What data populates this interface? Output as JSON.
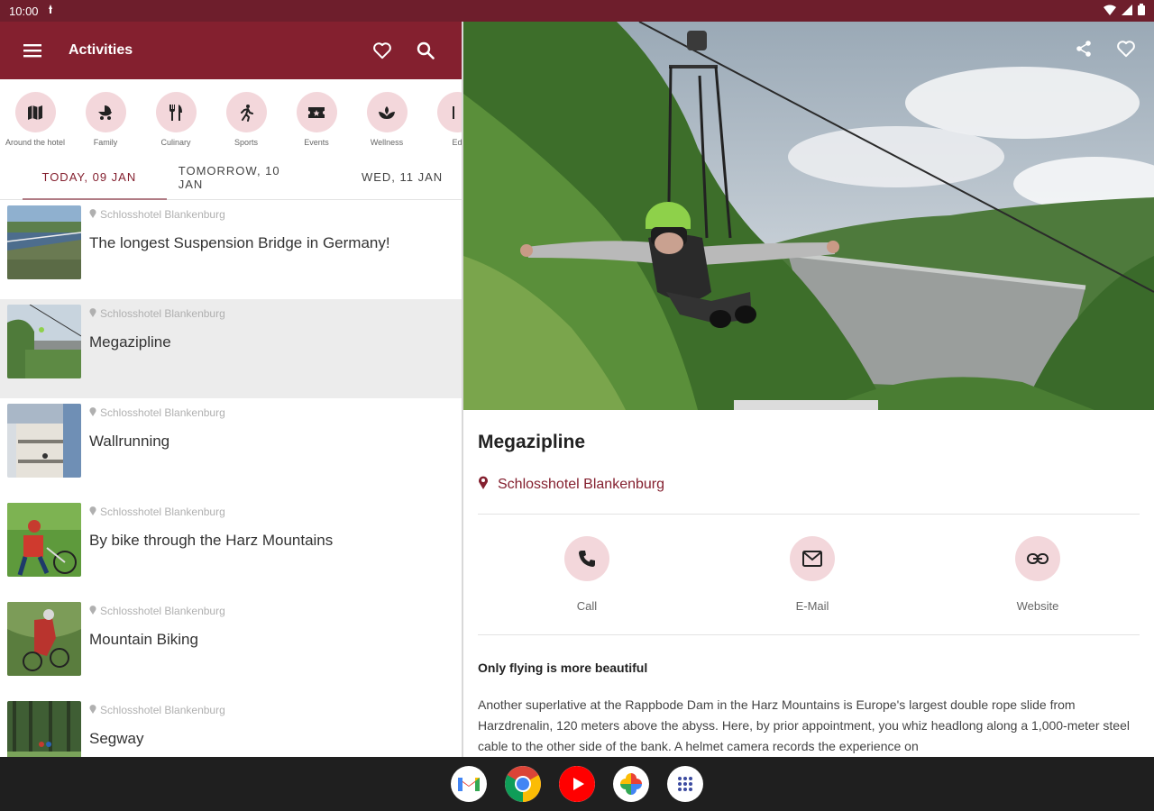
{
  "status_bar": {
    "time": "10:00"
  },
  "app_bar": {
    "title": "Activities"
  },
  "categories": [
    {
      "label": "Around the hotel",
      "icon": "map-icon"
    },
    {
      "label": "Family",
      "icon": "stroller-icon"
    },
    {
      "label": "Culinary",
      "icon": "cutlery-icon"
    },
    {
      "label": "Sports",
      "icon": "running-icon"
    },
    {
      "label": "Events",
      "icon": "ticket-icon"
    },
    {
      "label": "Wellness",
      "icon": "spa-icon"
    },
    {
      "label": "Ed",
      "icon": "category-icon"
    }
  ],
  "date_tabs": [
    {
      "label": "TODAY, 09 JAN",
      "active": true
    },
    {
      "label": "TOMORROW, 10 JAN",
      "active": false
    },
    {
      "label": "WED, 11 JAN",
      "active": false
    }
  ],
  "activities": [
    {
      "location": "Schlosshotel Blankenburg",
      "title": "The longest Suspension Bridge in Germany!"
    },
    {
      "location": "Schlosshotel Blankenburg",
      "title": "Megazipline"
    },
    {
      "location": "Schlosshotel Blankenburg",
      "title": "Wallrunning"
    },
    {
      "location": "Schlosshotel Blankenburg",
      "title": "By bike through the Harz Mountains"
    },
    {
      "location": "Schlosshotel Blankenburg",
      "title": "Mountain Biking"
    },
    {
      "location": "Schlosshotel Blankenburg",
      "title": "Segway"
    }
  ],
  "detail": {
    "title": "Megazipline",
    "location": "Schlosshotel Blankenburg",
    "contacts": {
      "call": "Call",
      "email": "E-Mail",
      "website": "Website"
    },
    "subtitle": "Only flying is more beautiful",
    "body": "Another superlative at the Rappbode Dam in the Harz Mountains is Europe's largest double rope slide from Harzdrenalin, 120 meters above the abyss. Here, by prior appointment, you whiz headlong along a 1,000-meter steel cable to the other side of the bank. A helmet camera records the experience on"
  },
  "colors": {
    "status_bar": "#6e1e2c",
    "app_bar": "#84202f",
    "accent_circle": "#f3d7db",
    "selected_row": "#ececec"
  }
}
